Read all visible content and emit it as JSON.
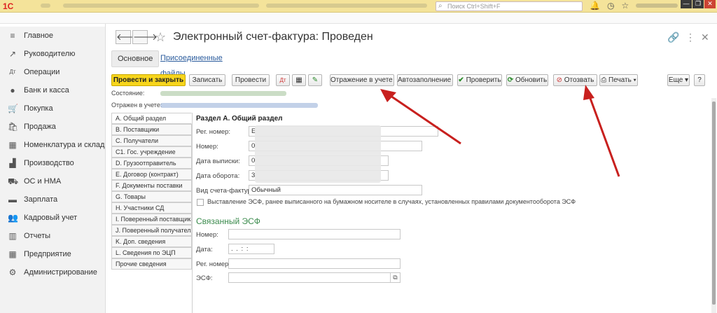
{
  "app": {
    "logo_text": "1С",
    "search_placeholder": "Поиск Ctrl+Shift+F",
    "window_buttons": [
      "—",
      "❐",
      "✕"
    ]
  },
  "sidebar": {
    "items": [
      {
        "label": "Главное",
        "icon": "home-icon",
        "glyph": "≡"
      },
      {
        "label": "Руководителю",
        "icon": "chart-icon",
        "glyph": "↗"
      },
      {
        "label": "Операции",
        "icon": "dt-kt-icon",
        "glyph": "Дт"
      },
      {
        "label": "Банк и касса",
        "icon": "coin-icon",
        "glyph": "●"
      },
      {
        "label": "Покупка",
        "icon": "cart-icon",
        "glyph": "🛒"
      },
      {
        "label": "Продажа",
        "icon": "bag-icon",
        "glyph": "🛍"
      },
      {
        "label": "Номенклатура и склад",
        "icon": "grid-icon",
        "glyph": "▦"
      },
      {
        "label": "Производство",
        "icon": "factory-icon",
        "glyph": "▟"
      },
      {
        "label": "ОС и НМА",
        "icon": "truck-icon",
        "glyph": "⛟"
      },
      {
        "label": "Зарплата",
        "icon": "money-icon",
        "glyph": "▬"
      },
      {
        "label": "Кадровый учет",
        "icon": "people-icon",
        "glyph": "👥"
      },
      {
        "label": "Отчеты",
        "icon": "reports-icon",
        "glyph": "▥"
      },
      {
        "label": "Предприятие",
        "icon": "building-icon",
        "glyph": "▦"
      },
      {
        "label": "Администрирование",
        "icon": "gear-icon",
        "glyph": "⚙"
      }
    ]
  },
  "document": {
    "title": "Электронный счет-фактура: Проведен",
    "tabs": {
      "main": "Основное",
      "files": "Присоединенные файлы"
    }
  },
  "toolbar": {
    "post_close": "Провести и закрыть",
    "save": "Записать",
    "post": "Провести",
    "reflection": "Отражение в учете",
    "autofill": "Автозаполнение",
    "check": "Проверить",
    "refresh": "Обновить",
    "recall": "Отозвать",
    "print": "Печать",
    "more": "Еще",
    "help": "?"
  },
  "status": {
    "state_label": "Состояние:",
    "reflected_label": "Отражен в учете:"
  },
  "left_nav": [
    "A. Общий раздел",
    "B. Поставщики",
    "C. Получатели",
    "C1. Гос. учреждение",
    "D. Грузоотправитель",
    "E. Договор (контракт)",
    "F. Документы поставки",
    "G. Товары",
    "H. Участники СД",
    "I. Поверенный поставщика",
    "J. Поверенный получателя",
    "K. Доп. сведения",
    "L. Сведения по ЭЦП",
    "Прочие сведения"
  ],
  "form": {
    "section_title": "Раздел А. Общий раздел",
    "reg_number_label": "Рег. номер:",
    "reg_number_value": "E",
    "number_label": "Номер:",
    "number_value": "0",
    "issue_date_label": "Дата выписки:",
    "issue_date_value": "0",
    "turnover_date_label": "Дата оборота:",
    "turnover_date_value": "3",
    "invoice_type_label": "Вид счета-фактуры:",
    "invoice_type_value": "Обычный",
    "checkbox_label": "Выставление ЭСФ, ранее выписанного на бумажном носителе в случаях, установленных правилами документооборота ЭСФ",
    "related_title": "Связанный ЭСФ",
    "rel_number_label": "Номер:",
    "rel_date_label": "Дата:",
    "rel_date_value": ". .   : :",
    "rel_reg_label": "Рег. номер:",
    "rel_esf_label": "ЭСФ:"
  }
}
